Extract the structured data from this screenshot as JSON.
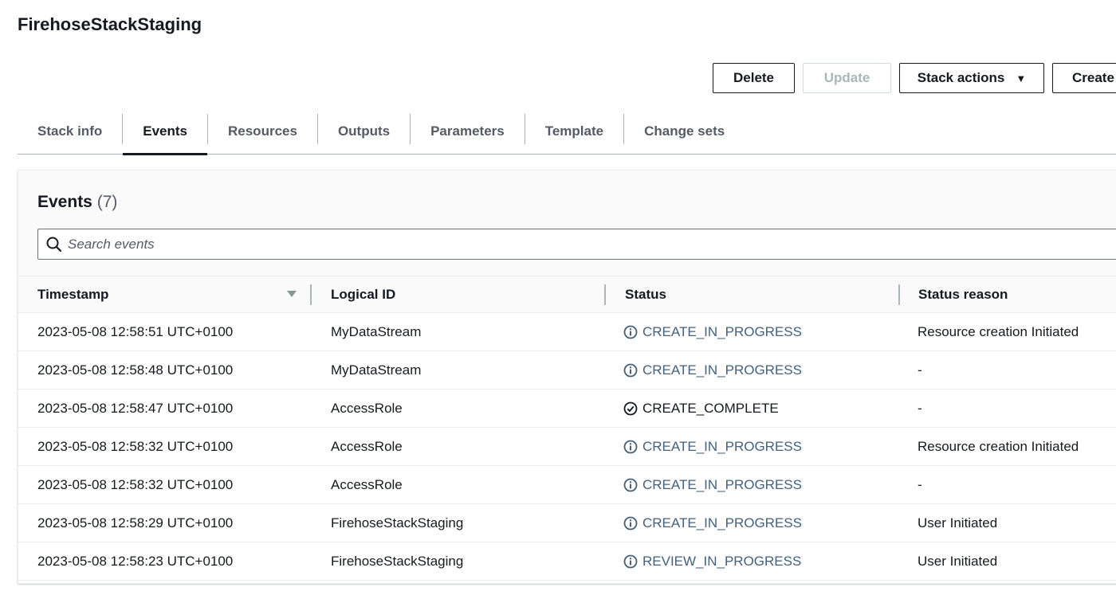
{
  "page": {
    "title": "FirehoseStackStaging"
  },
  "actions": {
    "delete_label": "Delete",
    "update_label": "Update",
    "stack_actions_label": "Stack actions",
    "create_label": "Create"
  },
  "tabs": [
    {
      "label": "Stack info"
    },
    {
      "label": "Events"
    },
    {
      "label": "Resources"
    },
    {
      "label": "Outputs"
    },
    {
      "label": "Parameters"
    },
    {
      "label": "Template"
    },
    {
      "label": "Change sets"
    }
  ],
  "active_tab": "Events",
  "events": {
    "title": "Events",
    "count": "(7)",
    "search_placeholder": "Search events",
    "columns": [
      "Timestamp",
      "Logical ID",
      "Status",
      "Status reason"
    ],
    "rows": [
      {
        "timestamp": "2023-05-08 12:58:51 UTC+0100",
        "logical_id": "MyDataStream",
        "status": "CREATE_IN_PROGRESS",
        "status_type": "info",
        "reason": "Resource creation Initiated"
      },
      {
        "timestamp": "2023-05-08 12:58:48 UTC+0100",
        "logical_id": "MyDataStream",
        "status": "CREATE_IN_PROGRESS",
        "status_type": "info",
        "reason": "-"
      },
      {
        "timestamp": "2023-05-08 12:58:47 UTC+0100",
        "logical_id": "AccessRole",
        "status": "CREATE_COMPLETE",
        "status_type": "complete",
        "reason": "-"
      },
      {
        "timestamp": "2023-05-08 12:58:32 UTC+0100",
        "logical_id": "AccessRole",
        "status": "CREATE_IN_PROGRESS",
        "status_type": "info",
        "reason": "Resource creation Initiated"
      },
      {
        "timestamp": "2023-05-08 12:58:32 UTC+0100",
        "logical_id": "AccessRole",
        "status": "CREATE_IN_PROGRESS",
        "status_type": "info",
        "reason": "-"
      },
      {
        "timestamp": "2023-05-08 12:58:29 UTC+0100",
        "logical_id": "FirehoseStackStaging",
        "status": "CREATE_IN_PROGRESS",
        "status_type": "info",
        "reason": "User Initiated"
      },
      {
        "timestamp": "2023-05-08 12:58:23 UTC+0100",
        "logical_id": "FirehoseStackStaging",
        "status": "REVIEW_IN_PROGRESS",
        "status_type": "info",
        "reason": "User Initiated"
      }
    ]
  },
  "icons": {
    "search": "search-icon",
    "info": "info-circle-icon",
    "complete": "check-circle-icon",
    "sort": "sort-descending-icon",
    "dropdown": "caret-down-icon"
  },
  "colors": {
    "text": "#16191f",
    "info_status": "#44617b",
    "disabled": "#aab7b8"
  }
}
